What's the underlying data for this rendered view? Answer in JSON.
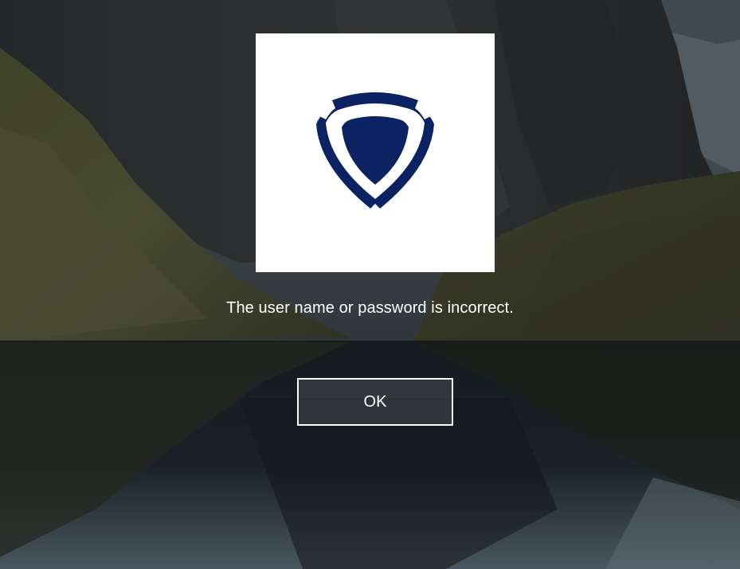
{
  "login_error": {
    "message": "The user name or password is incorrect.",
    "ok_label": "OK"
  },
  "logo": {
    "icon": "shield-icon",
    "color": "#0b2363",
    "tile_color": "#ffffff"
  },
  "colors": {
    "text": "#ffffff",
    "button_border": "#ffffff"
  }
}
